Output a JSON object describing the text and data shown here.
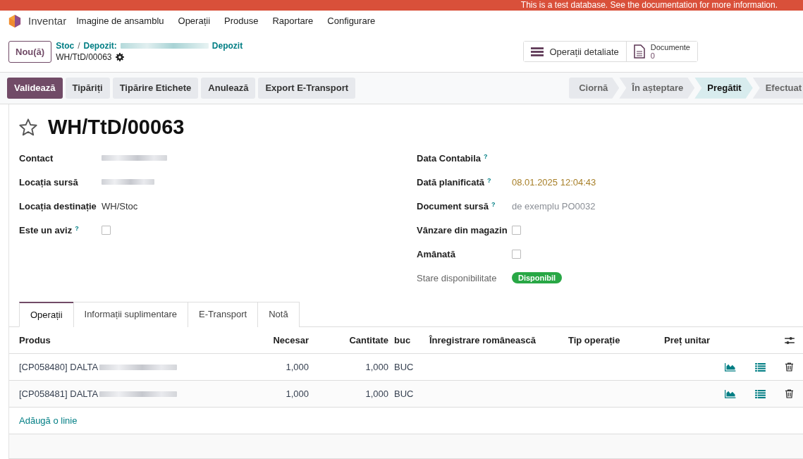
{
  "banner": {
    "text": "This is a test database. See the documentation for more information."
  },
  "navbar": {
    "app": "Inventar",
    "menu": [
      "Imagine de ansamblu",
      "Operații",
      "Produse",
      "Raportare",
      "Configurare"
    ]
  },
  "control_panel": {
    "new_button": "Nou(ă)",
    "separator": "/",
    "breadcrumbs": [
      {
        "kind": "link",
        "label": "Stoc"
      },
      {
        "kind": "redacted",
        "label": "Depozit:",
        "label_end": "Depozit"
      }
    ],
    "record": "WH/TtD/00063",
    "smart_buttons": [
      {
        "kind": "list",
        "label": "Operații detaliate"
      },
      {
        "kind": "document",
        "label": "Documente",
        "count": "0"
      }
    ]
  },
  "actions": [
    {
      "label": "Validează",
      "primary": true
    },
    {
      "label": "Tipăriți",
      "primary": false
    },
    {
      "label": "Tipărire Etichete",
      "primary": false
    },
    {
      "label": "Anulează",
      "primary": false
    },
    {
      "label": "Export E-Transport",
      "primary": false
    }
  ],
  "stages": [
    {
      "label": "Ciornă",
      "selected": false
    },
    {
      "label": "În așteptare",
      "selected": false
    },
    {
      "label": "Pregătit",
      "selected": true
    },
    {
      "label": "Efectuat",
      "selected": false
    }
  ],
  "form": {
    "starred": false,
    "title": "WH/TtD/00063",
    "left_fields": [
      {
        "label": "Contact",
        "kind": "redacted"
      },
      {
        "label": "Locația sursă",
        "kind": "redacted"
      },
      {
        "label": "Locația destinație",
        "kind": "text",
        "value": "WH/Stoc"
      },
      {
        "label": "Este un aviz",
        "help_mark": "?",
        "kind": "checkbox",
        "checked": false
      }
    ],
    "right_fields": [
      {
        "label": "Data Contabila",
        "help_mark": "?",
        "kind": "empty"
      },
      {
        "label": "Dată planificată",
        "help_mark": "?",
        "kind": "date",
        "value": "08.01.2025 12:04:43"
      },
      {
        "label": "Document sursă",
        "help_mark": "?",
        "kind": "input",
        "placeholder": "de exemplu PO0032"
      },
      {
        "label": "Vânzare din magazin",
        "kind": "checkbox",
        "checked": false
      },
      {
        "label": "Amânată",
        "kind": "checkbox",
        "checked": false
      },
      {
        "label": "Stare disponibilitate",
        "kind": "badge",
        "value": "Disponibil",
        "color": "#28a745"
      }
    ]
  },
  "tabs": [
    {
      "label": "Operații",
      "selected": true
    },
    {
      "label": "Informații suplimentare",
      "selected": false
    },
    {
      "label": "E-Transport",
      "selected": false
    },
    {
      "label": "Notă",
      "selected": false
    }
  ],
  "table": {
    "columns": [
      "Produs",
      "Necesar",
      "Cantitate",
      "buc",
      "Înregistrare românească",
      "Tip operație",
      "Preț unitar"
    ],
    "rows": [
      {
        "product": "[CP058480] DALTA",
        "necesar": "1,000",
        "cantitate": "1,000",
        "uom": "BUC"
      },
      {
        "product": "[CP058481] DALTA",
        "necesar": "1,000",
        "cantitate": "1,000",
        "uom": "BUC"
      }
    ],
    "add_line": "Adăugă o linie"
  }
}
